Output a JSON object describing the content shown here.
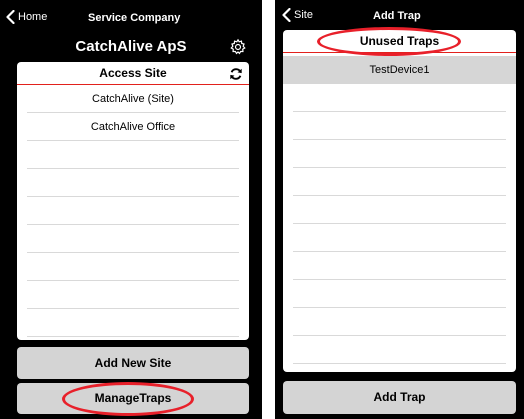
{
  "left_screen": {
    "nav": {
      "back_label": "Home",
      "title": "Service Company"
    },
    "company_name": "CatchAlive ApS",
    "settings_icon": "gear-icon",
    "site_list": {
      "header": "Access Site",
      "refresh_icon": "refresh-icon",
      "items": [
        "CatchAlive (Site)",
        "CatchAlive Office",
        "",
        "",
        "",
        "",
        "",
        "",
        "",
        ""
      ]
    },
    "add_site_button": "Add New Site",
    "manage_traps_button": "ManageTraps"
  },
  "right_screen": {
    "nav": {
      "back_label": "Site",
      "title": "Add Trap"
    },
    "trap_list": {
      "header": "Unused Traps",
      "items": [
        "TestDevice1",
        "",
        "",
        "",
        "",
        "",
        "",
        "",
        "",
        "",
        ""
      ]
    },
    "add_trap_button": "Add Trap"
  },
  "colors": {
    "highlight": "#e8202a",
    "header_rule": "#e2211c",
    "button_gray": "#d4d4d4",
    "selected_row": "#d6d6d6"
  }
}
